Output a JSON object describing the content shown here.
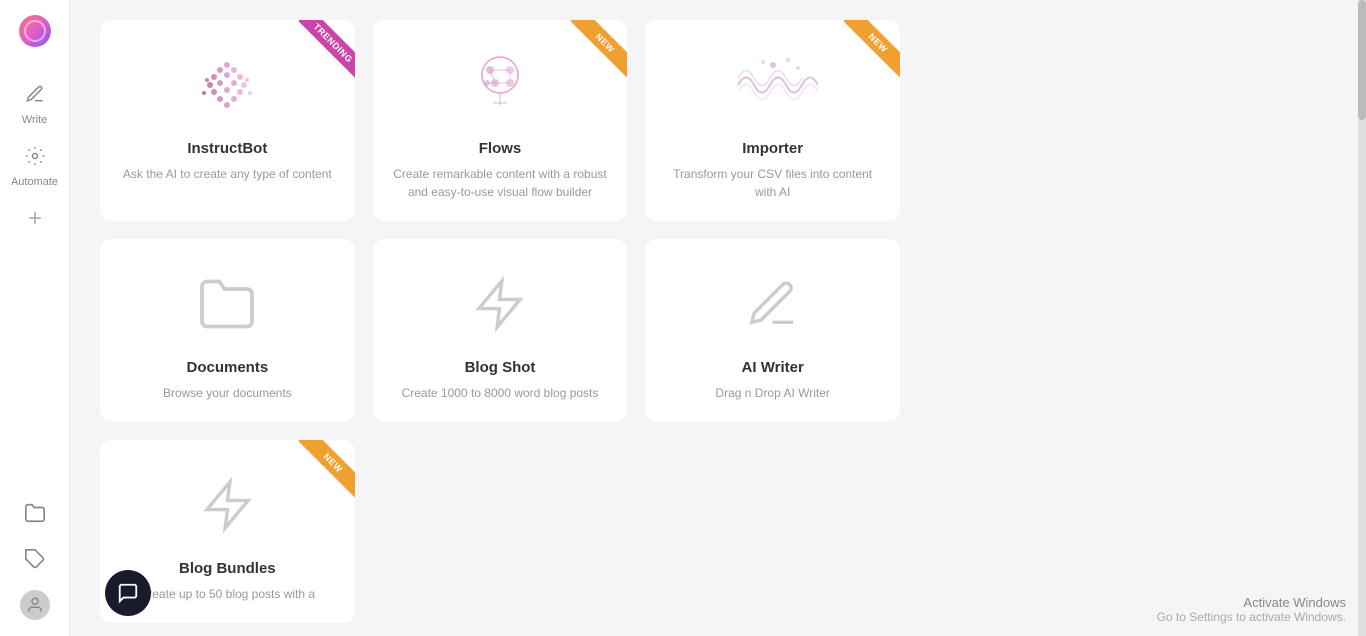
{
  "sidebar": {
    "logo_alt": "App Logo",
    "items": [
      {
        "label": "Write",
        "icon": "✎",
        "id": "write"
      },
      {
        "label": "Automate",
        "icon": "⚙",
        "id": "automate"
      }
    ],
    "bottom_items": [
      {
        "icon": "📁",
        "id": "documents"
      },
      {
        "icon": "🏷",
        "id": "tags"
      },
      {
        "icon": "👤",
        "id": "profile"
      }
    ],
    "add_label": "+"
  },
  "cards": [
    {
      "id": "instructbot",
      "title": "InstructBot",
      "desc": "Ask the AI to create any type of content",
      "badge": "TRENDING",
      "badge_type": "trending",
      "has_image": "dots"
    },
    {
      "id": "flows",
      "title": "Flows",
      "desc": "Create remarkable content with a robust and easy-to-use visual flow builder",
      "badge": "NEW",
      "badge_type": "new",
      "has_image": "brain"
    },
    {
      "id": "importer",
      "title": "Importer",
      "desc": "Transform your CSV files into content with AI",
      "badge": "NEW",
      "badge_type": "new",
      "has_image": "wave"
    },
    {
      "id": "documents",
      "title": "Documents",
      "desc": "Browse your documents",
      "badge": "",
      "badge_type": "",
      "has_image": "folder"
    },
    {
      "id": "blog-shot",
      "title": "Blog Shot",
      "desc": "Create 1000 to 8000 word blog posts",
      "badge": "",
      "badge_type": "",
      "has_image": "bolt"
    },
    {
      "id": "ai-writer",
      "title": "AI Writer",
      "desc": "Drag n Drop AI Writer",
      "badge": "",
      "badge_type": "",
      "has_image": "pen"
    },
    {
      "id": "blog-bundles",
      "title": "Blog Bundles",
      "desc": "Create up to 50 blog posts with a",
      "badge": "NEW",
      "badge_type": "new",
      "has_image": "bolt"
    }
  ],
  "windows_activation": {
    "title": "Activate Windows",
    "desc": "Go to Settings to activate Windows."
  },
  "chat_bubble": {
    "label": "Chat"
  }
}
